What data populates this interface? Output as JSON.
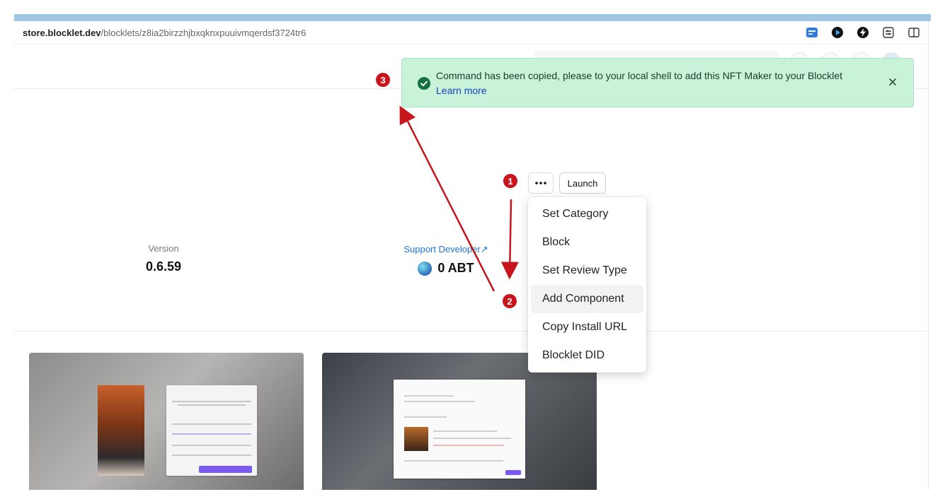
{
  "browser": {
    "url_host": "store.blocklet.dev",
    "url_path": "/blocklets/z8ia2birzzhjbxqknxpuuivmqerdsf3724tr6",
    "icons": [
      "wallet-icon",
      "play-icon",
      "bolt-icon",
      "extensions-icon",
      "sidebar-icon"
    ]
  },
  "info": {
    "version_label": "Version",
    "version_value": "0.6.59",
    "support_label": "Support Developer",
    "support_arrow": "↗",
    "support_value": "0 ABT"
  },
  "actions": {
    "launch_label": "Launch",
    "more_icon": "more-horizontal-icon"
  },
  "menu": {
    "items": [
      "Set Category",
      "Block",
      "Set Review Type",
      "Add Component",
      "Copy Install URL",
      "Blocklet DID"
    ],
    "highlighted_index": 3
  },
  "toast": {
    "message": "Command has been copied, please to your local shell to add this NFT Maker to your Blocklet",
    "link": "Learn more",
    "icon": "check-circle-icon",
    "close_icon": "close-icon"
  },
  "annotations": [
    "1",
    "2",
    "3"
  ],
  "colors": {
    "toast_bg": "#c9f3d9",
    "annotation_red": "#c8141b",
    "link_blue": "#1f74d6"
  }
}
